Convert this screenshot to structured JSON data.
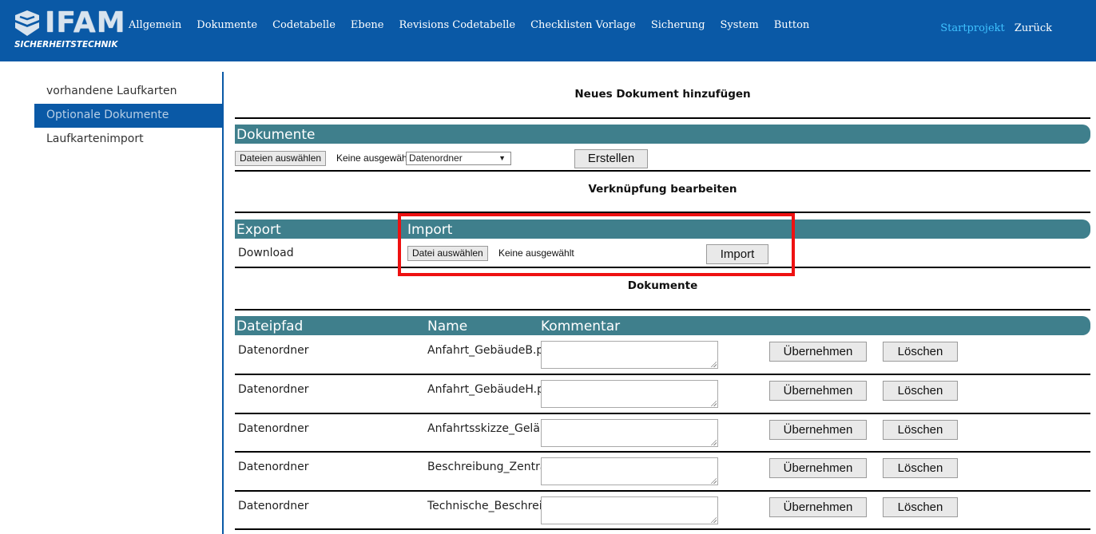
{
  "topbar": {
    "logo_text": "IFAM",
    "logo_subtitle": "SICHERHEITSTECHNIK",
    "nav_items": [
      "Allgemein",
      "Dokumente",
      "Codetabelle",
      "Ebene",
      "Revisions Codetabelle",
      "Checklisten Vorlage",
      "Sicherung",
      "System",
      "Button"
    ],
    "start_project": "Startprojekt",
    "back": "Zurück"
  },
  "sidebar": {
    "items": [
      {
        "label": "vorhandene Laufkarten"
      },
      {
        "label": "Optionale Dokumente"
      },
      {
        "label": "Laufkartenimport"
      }
    ]
  },
  "new_document": {
    "heading": "Neues Dokument hinzufügen",
    "band_label": "Dokumente",
    "file_button": "Dateien auswählen",
    "file_status": "Keine ausgewählt",
    "folder_select": "Datenordner",
    "create_button": "Erstellen"
  },
  "link_edit": {
    "heading": "Verknüpfung bearbeiten",
    "export_label": "Export",
    "import_label": "Import",
    "download_label": "Download",
    "file_button": "Datei auswählen",
    "file_status": "Keine ausgewählt",
    "import_button": "Import"
  },
  "documents": {
    "heading": "Dokumente",
    "columns": [
      "Dateipfad",
      "Name",
      "Kommentar"
    ],
    "apply_label": "Übernehmen",
    "delete_label": "Löschen",
    "rows": [
      {
        "path": "Datenordner",
        "name": "Anfahrt_GebäudeB.pdf",
        "comment": ""
      },
      {
        "path": "Datenordner",
        "name": "Anfahrt_GebäudeH.pdf",
        "comment": ""
      },
      {
        "path": "Datenordner",
        "name": "Anfahrtsskizze_Gelände",
        "comment": ""
      },
      {
        "path": "Datenordner",
        "name": "Beschreibung_Zentrale",
        "comment": ""
      },
      {
        "path": "Datenordner",
        "name": "Technische_Beschreibung",
        "comment": ""
      }
    ]
  },
  "colors": {
    "nav_bg": "#0a59a6",
    "band_bg": "#3f7f8c",
    "highlight": "#ee1111",
    "start_link": "#3fc2ff"
  }
}
